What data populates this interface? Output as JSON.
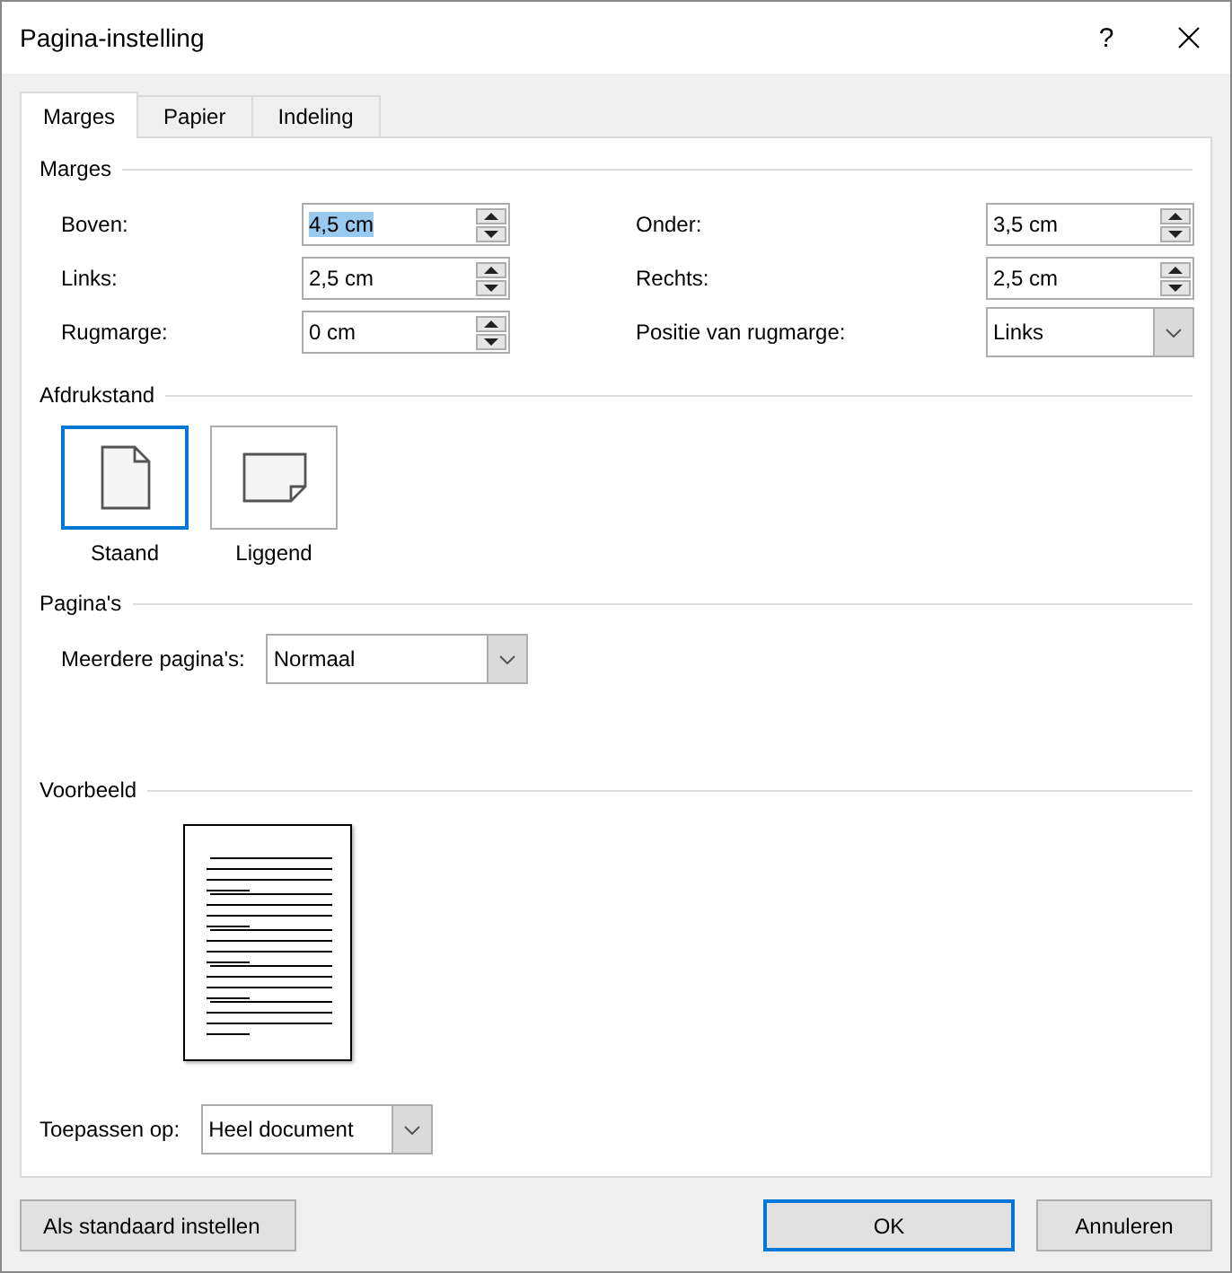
{
  "window": {
    "title": "Pagina-instelling",
    "help": "?"
  },
  "tabs": [
    {
      "label": "Marges",
      "selected": true
    },
    {
      "label": "Papier",
      "selected": false
    },
    {
      "label": "Indeling",
      "selected": false
    }
  ],
  "margins": {
    "title": "Marges",
    "fields": [
      {
        "label": "Boven:",
        "value": "4,5 cm",
        "kind": "spin",
        "highlighted": true
      },
      {
        "label": "Onder:",
        "value": "3,5 cm",
        "kind": "spin",
        "highlighted": false
      },
      {
        "label": "Links:",
        "value": "2,5 cm",
        "kind": "spin",
        "highlighted": false
      },
      {
        "label": "Rechts:",
        "value": "2,5 cm",
        "kind": "spin",
        "highlighted": false
      },
      {
        "label": "Rugmarge:",
        "value": "0 cm",
        "kind": "spin",
        "highlighted": false
      },
      {
        "label": "Positie van rugmarge:",
        "value": "Links",
        "kind": "select",
        "highlighted": false
      }
    ]
  },
  "orientation": {
    "title": "Afdrukstand",
    "options": [
      {
        "label": "Staand",
        "kind": "portrait",
        "selected": true
      },
      {
        "label": "Liggend",
        "kind": "landscape",
        "selected": false
      }
    ]
  },
  "pages": {
    "title": "Pagina's",
    "label": "Meerdere pagina's:",
    "value": "Normaal"
  },
  "preview": {
    "title": "Voorbeeld"
  },
  "apply": {
    "label": "Toepassen op:",
    "value": "Heel document"
  },
  "buttons": [
    {
      "label": "Als standaard instellen",
      "kind": "secondary"
    },
    {
      "label": "OK",
      "kind": "default"
    },
    {
      "label": "Annuleren",
      "kind": "secondary"
    }
  ]
}
